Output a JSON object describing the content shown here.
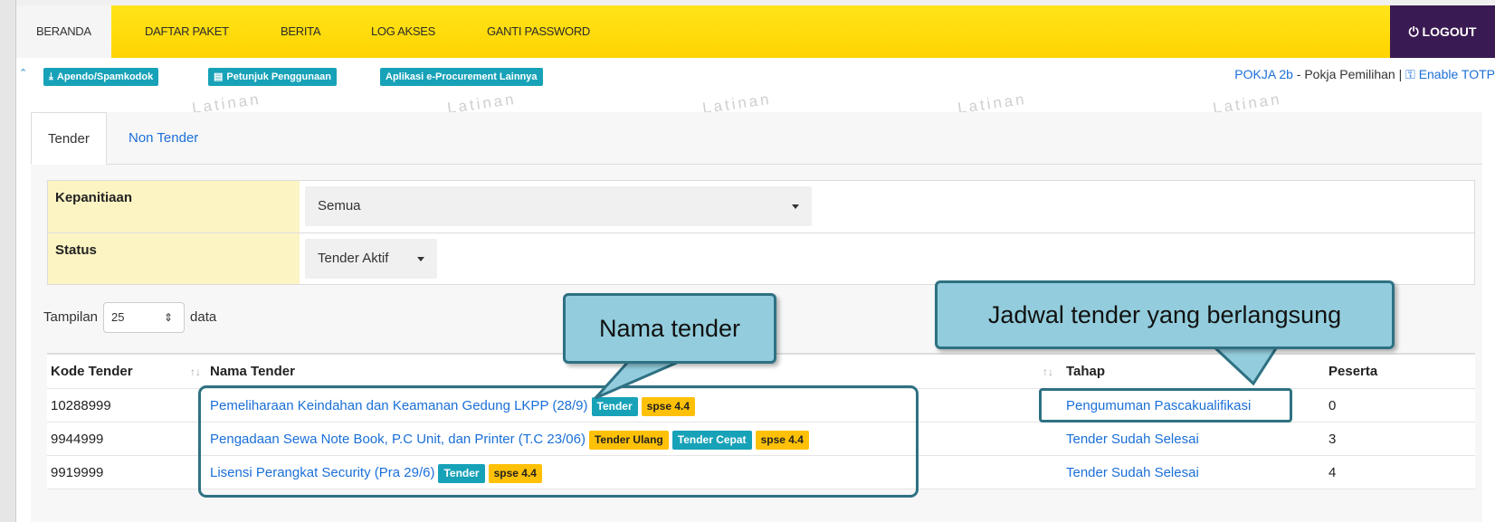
{
  "nav": {
    "items": [
      "BERANDA",
      "DAFTAR PAKET",
      "BERITA",
      "LOG AKSES",
      "GANTI PASSWORD"
    ],
    "active": "BERANDA",
    "logout": "LOGOUT",
    "bg_color": "#ffd400",
    "logout_color": "#3a1a52"
  },
  "subbar": {
    "buttons": [
      {
        "icon": "download-icon",
        "label": "Apendo/Spamkodok"
      },
      {
        "icon": "book-icon",
        "label": "Petunjuk Penggunaan"
      },
      {
        "icon": "",
        "label": "Aplikasi e-Procurement Lainnya"
      }
    ],
    "user_role": "POKJA 2b",
    "user_desc": " - Pokja Pemilihan | ",
    "enable_totp": "Enable TOTP"
  },
  "watermark": "Latinan",
  "tabs": [
    "Tender",
    "Non Tender"
  ],
  "filters": {
    "kepanitiaan_label": "Kepanitiaan",
    "kepanitiaan_value": "Semua",
    "status_label": "Status",
    "status_value": "Tender Aktif"
  },
  "length": {
    "prefix": "Tampilan",
    "value": "25",
    "suffix": "data"
  },
  "table": {
    "headers": {
      "kode": "Kode Tender",
      "nama": "Nama Tender",
      "tahap": "Tahap",
      "peserta": "Peserta"
    },
    "rows": [
      {
        "kode": "10288999",
        "nama": "Pemeliharaan Keindahan dan Keamanan Gedung LKPP (28/9)",
        "badges": [
          {
            "text": "Tender",
            "style": "teal"
          },
          {
            "text": "spse 4.4",
            "style": "yellow"
          }
        ],
        "tahap": "Pengumuman Pascakualifikasi",
        "peserta": "0"
      },
      {
        "kode": "9944999",
        "nama": "Pengadaan Sewa Note Book, P.C Unit, dan Printer (T.C 23/06)",
        "badges": [
          {
            "text": "Tender Ulang",
            "style": "yellow"
          },
          {
            "text": "Tender Cepat",
            "style": "teal"
          },
          {
            "text": "spse 4.4",
            "style": "yellow"
          }
        ],
        "tahap": "Tender Sudah Selesai",
        "peserta": "3"
      },
      {
        "kode": "9919999",
        "nama": "Lisensi Perangkat Security (Pra 29/6)",
        "badges": [
          {
            "text": "Tender",
            "style": "teal"
          },
          {
            "text": "spse 4.4",
            "style": "yellow"
          }
        ],
        "tahap": "Tender Sudah Selesai",
        "peserta": "4"
      }
    ]
  },
  "callouts": {
    "nama": "Nama tender",
    "jadwal": "Jadwal tender yang berlangsung"
  }
}
